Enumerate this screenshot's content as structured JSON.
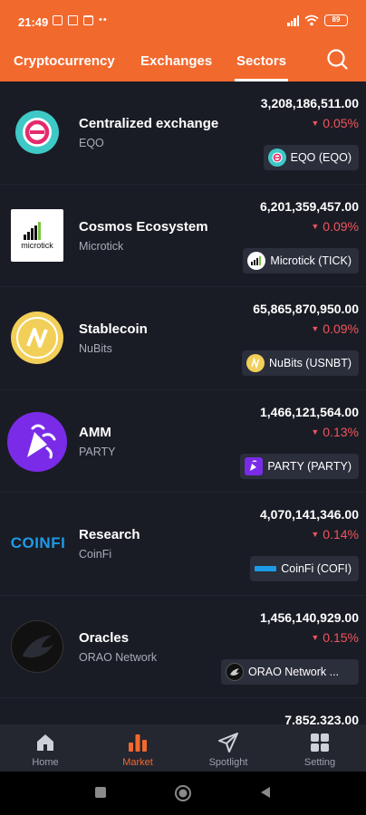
{
  "status": {
    "time": "21:49",
    "dots": "••",
    "battery": "89"
  },
  "tabs": [
    "Cryptocurrency",
    "Exchanges",
    "Sectors"
  ],
  "rows": [
    {
      "name": "Centralized exchange",
      "sub": "EQO",
      "value": "3,208,186,511.00",
      "change": "0.05%",
      "chip": "EQO (EQO)"
    },
    {
      "name": "Cosmos Ecosystem",
      "sub": "Microtick",
      "value": "6,201,359,457.00",
      "change": "0.09%",
      "chip": "Microtick (TICK)"
    },
    {
      "name": "Stablecoin",
      "sub": "NuBits",
      "value": "65,865,870,950.00",
      "change": "0.09%",
      "chip": "NuBits (USNBT)"
    },
    {
      "name": "AMM",
      "sub": "PARTY",
      "value": "1,466,121,564.00",
      "change": "0.13%",
      "chip": "PARTY (PARTY)"
    },
    {
      "name": "Research",
      "sub": "CoinFi",
      "value": "4,070,141,346.00",
      "change": "0.14%",
      "chip": "CoinFi (COFI)"
    },
    {
      "name": "Oracles",
      "sub": "ORAO Network",
      "value": "1,456,140,929.00",
      "change": "0.15%",
      "chip": "ORAO Network ..."
    },
    {
      "name": "",
      "sub": "",
      "value": "7,852,323.00",
      "change": "",
      "chip": ""
    }
  ],
  "logos": {
    "microtick": "microtick",
    "coinfi": "COINFI"
  },
  "bottom_nav": [
    "Home",
    "Market",
    "Spotlight",
    "Setting"
  ],
  "colors": {
    "accent": "#f2692e",
    "down": "#f0545d",
    "bg": "#1a1c25"
  }
}
